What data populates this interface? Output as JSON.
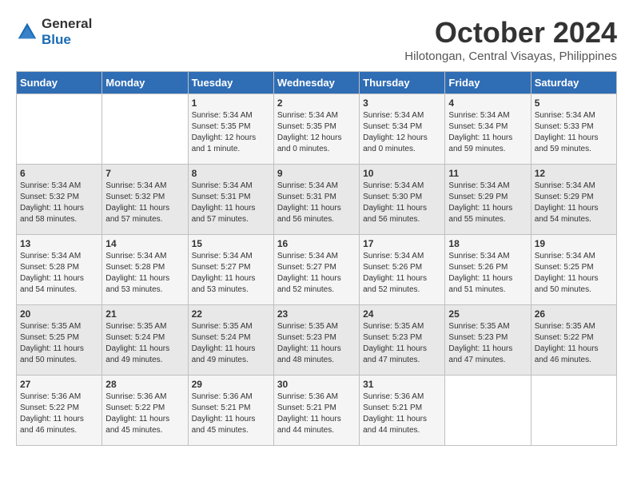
{
  "logo": {
    "general": "General",
    "blue": "Blue"
  },
  "header": {
    "month": "October 2024",
    "location": "Hilotongan, Central Visayas, Philippines"
  },
  "weekdays": [
    "Sunday",
    "Monday",
    "Tuesday",
    "Wednesday",
    "Thursday",
    "Friday",
    "Saturday"
  ],
  "weeks": [
    [
      {
        "day": "",
        "content": ""
      },
      {
        "day": "",
        "content": ""
      },
      {
        "day": "1",
        "content": "Sunrise: 5:34 AM\nSunset: 5:35 PM\nDaylight: 12 hours\nand 1 minute."
      },
      {
        "day": "2",
        "content": "Sunrise: 5:34 AM\nSunset: 5:35 PM\nDaylight: 12 hours\nand 0 minutes."
      },
      {
        "day": "3",
        "content": "Sunrise: 5:34 AM\nSunset: 5:34 PM\nDaylight: 12 hours\nand 0 minutes."
      },
      {
        "day": "4",
        "content": "Sunrise: 5:34 AM\nSunset: 5:34 PM\nDaylight: 11 hours\nand 59 minutes."
      },
      {
        "day": "5",
        "content": "Sunrise: 5:34 AM\nSunset: 5:33 PM\nDaylight: 11 hours\nand 59 minutes."
      }
    ],
    [
      {
        "day": "6",
        "content": "Sunrise: 5:34 AM\nSunset: 5:32 PM\nDaylight: 11 hours\nand 58 minutes."
      },
      {
        "day": "7",
        "content": "Sunrise: 5:34 AM\nSunset: 5:32 PM\nDaylight: 11 hours\nand 57 minutes."
      },
      {
        "day": "8",
        "content": "Sunrise: 5:34 AM\nSunset: 5:31 PM\nDaylight: 11 hours\nand 57 minutes."
      },
      {
        "day": "9",
        "content": "Sunrise: 5:34 AM\nSunset: 5:31 PM\nDaylight: 11 hours\nand 56 minutes."
      },
      {
        "day": "10",
        "content": "Sunrise: 5:34 AM\nSunset: 5:30 PM\nDaylight: 11 hours\nand 56 minutes."
      },
      {
        "day": "11",
        "content": "Sunrise: 5:34 AM\nSunset: 5:29 PM\nDaylight: 11 hours\nand 55 minutes."
      },
      {
        "day": "12",
        "content": "Sunrise: 5:34 AM\nSunset: 5:29 PM\nDaylight: 11 hours\nand 54 minutes."
      }
    ],
    [
      {
        "day": "13",
        "content": "Sunrise: 5:34 AM\nSunset: 5:28 PM\nDaylight: 11 hours\nand 54 minutes."
      },
      {
        "day": "14",
        "content": "Sunrise: 5:34 AM\nSunset: 5:28 PM\nDaylight: 11 hours\nand 53 minutes."
      },
      {
        "day": "15",
        "content": "Sunrise: 5:34 AM\nSunset: 5:27 PM\nDaylight: 11 hours\nand 53 minutes."
      },
      {
        "day": "16",
        "content": "Sunrise: 5:34 AM\nSunset: 5:27 PM\nDaylight: 11 hours\nand 52 minutes."
      },
      {
        "day": "17",
        "content": "Sunrise: 5:34 AM\nSunset: 5:26 PM\nDaylight: 11 hours\nand 52 minutes."
      },
      {
        "day": "18",
        "content": "Sunrise: 5:34 AM\nSunset: 5:26 PM\nDaylight: 11 hours\nand 51 minutes."
      },
      {
        "day": "19",
        "content": "Sunrise: 5:34 AM\nSunset: 5:25 PM\nDaylight: 11 hours\nand 50 minutes."
      }
    ],
    [
      {
        "day": "20",
        "content": "Sunrise: 5:35 AM\nSunset: 5:25 PM\nDaylight: 11 hours\nand 50 minutes."
      },
      {
        "day": "21",
        "content": "Sunrise: 5:35 AM\nSunset: 5:24 PM\nDaylight: 11 hours\nand 49 minutes."
      },
      {
        "day": "22",
        "content": "Sunrise: 5:35 AM\nSunset: 5:24 PM\nDaylight: 11 hours\nand 49 minutes."
      },
      {
        "day": "23",
        "content": "Sunrise: 5:35 AM\nSunset: 5:23 PM\nDaylight: 11 hours\nand 48 minutes."
      },
      {
        "day": "24",
        "content": "Sunrise: 5:35 AM\nSunset: 5:23 PM\nDaylight: 11 hours\nand 47 minutes."
      },
      {
        "day": "25",
        "content": "Sunrise: 5:35 AM\nSunset: 5:23 PM\nDaylight: 11 hours\nand 47 minutes."
      },
      {
        "day": "26",
        "content": "Sunrise: 5:35 AM\nSunset: 5:22 PM\nDaylight: 11 hours\nand 46 minutes."
      }
    ],
    [
      {
        "day": "27",
        "content": "Sunrise: 5:36 AM\nSunset: 5:22 PM\nDaylight: 11 hours\nand 46 minutes."
      },
      {
        "day": "28",
        "content": "Sunrise: 5:36 AM\nSunset: 5:22 PM\nDaylight: 11 hours\nand 45 minutes."
      },
      {
        "day": "29",
        "content": "Sunrise: 5:36 AM\nSunset: 5:21 PM\nDaylight: 11 hours\nand 45 minutes."
      },
      {
        "day": "30",
        "content": "Sunrise: 5:36 AM\nSunset: 5:21 PM\nDaylight: 11 hours\nand 44 minutes."
      },
      {
        "day": "31",
        "content": "Sunrise: 5:36 AM\nSunset: 5:21 PM\nDaylight: 11 hours\nand 44 minutes."
      },
      {
        "day": "",
        "content": ""
      },
      {
        "day": "",
        "content": ""
      }
    ]
  ]
}
